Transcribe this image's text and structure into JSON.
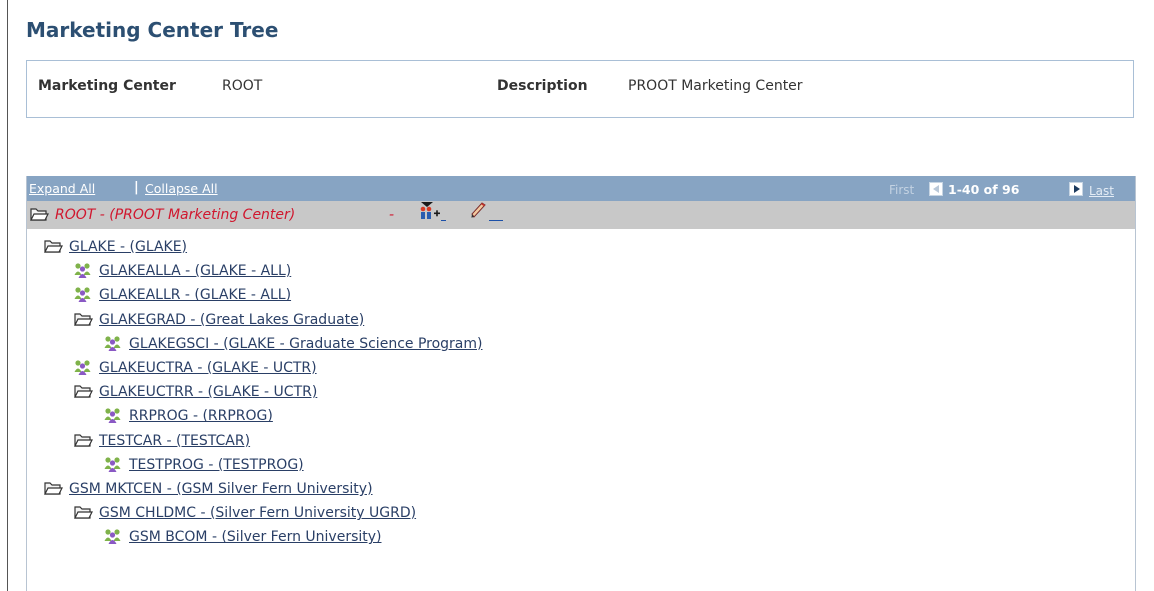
{
  "page": {
    "title": "Marketing Center Tree"
  },
  "header": {
    "marketing_center_label": "Marketing Center",
    "marketing_center_value": "ROOT",
    "description_label": "Description",
    "description_value": "PROOT Marketing Center"
  },
  "nav": {
    "expand_all": "Expand All",
    "separator": "|",
    "collapse_all": "Collapse All",
    "first": "First",
    "range": "1-40 of 96",
    "last": "Last"
  },
  "tree": {
    "root": {
      "label": "ROOT - (PROOT Marketing Center)",
      "suffix": "-",
      "icon": "folder-open-icon"
    },
    "nodes": [
      {
        "label": "GLAKE - (GLAKE)",
        "depth": 1,
        "icon": "folder-open-icon"
      },
      {
        "label": "GLAKEALLA - (GLAKE - ALL)",
        "depth": 2,
        "icon": "program-people-icon"
      },
      {
        "label": "GLAKEALLR - (GLAKE - ALL)",
        "depth": 2,
        "icon": "program-people-icon"
      },
      {
        "label": "GLAKEGRAD - (Great Lakes Graduate)",
        "depth": 2,
        "icon": "folder-open-icon"
      },
      {
        "label": "GLAKEGSCI - (GLAKE - Graduate Science Program)",
        "depth": 3,
        "icon": "program-people-icon"
      },
      {
        "label": "GLAKEUCTRA - (GLAKE - UCTR)",
        "depth": 2,
        "icon": "program-people-icon"
      },
      {
        "label": "GLAKEUCTRR - (GLAKE - UCTR)",
        "depth": 2,
        "icon": "folder-open-icon"
      },
      {
        "label": "RRPROG - (RRPROG)",
        "depth": 3,
        "icon": "program-people-icon"
      },
      {
        "label": "TESTCAR - (TESTCAR)",
        "depth": 2,
        "icon": "folder-open-icon"
      },
      {
        "label": "TESTPROG - (TESTPROG)",
        "depth": 3,
        "icon": "program-people-icon"
      },
      {
        "label": "GSM MKTCEN - (GSM Silver Fern University)",
        "depth": 1,
        "icon": "folder-open-icon"
      },
      {
        "label": "GSM CHLDMC - (Silver Fern University UGRD)",
        "depth": 2,
        "icon": "folder-open-icon"
      },
      {
        "label": "GSM BCOM - (Silver Fern University)",
        "depth": 3,
        "icon": "program-people-icon"
      }
    ]
  }
}
